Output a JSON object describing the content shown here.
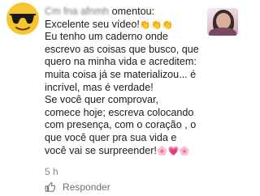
{
  "comment": {
    "author": "Cm fna afnmh",
    "header_suffix": "omentou:",
    "line_1": "Excelente seu vídeo!",
    "line_1_emoji": "👏👏👏",
    "body": " Eu tenho um caderno onde\nescrevo as coisas que busco, que\nquero na minha vida e acreditem:\nmuita coisa já se materializou... é\nincrível, mas é verdade!\n Se você quer comprovar,\ncomece hoje; escreva colocando\ncom presença, com o coração , o\nque você quer pra sua vida e\nvocê vai se surpreender!",
    "end_emoji": "🌸💗🌸",
    "time": "5 h",
    "reply_label": "Responder"
  },
  "icons": {
    "avatar": "sunglasses-emoji-icon",
    "like": "thumbs-up-icon"
  },
  "colors": {
    "text": "#202020",
    "meta": "#8a8a8a",
    "avatar_yellow": "#f7c52f"
  }
}
